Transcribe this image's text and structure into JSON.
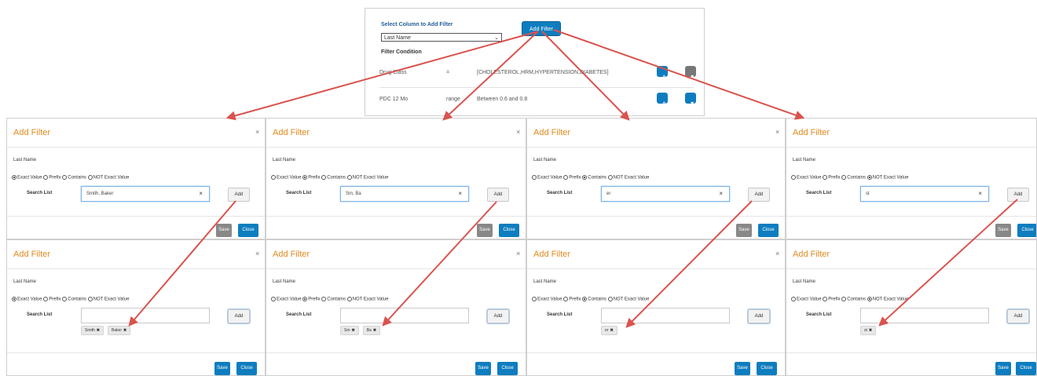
{
  "top": {
    "select_label": "Select Column to Add Filter",
    "select_value": "Last Name",
    "add_filter": "Add Filter",
    "condition_heading": "Filter Condition",
    "rows": [
      {
        "column": "Drug Class",
        "op": "=",
        "value": "[CHOLESTEROL,HRM,HYPERTENSION,DIABETES]"
      },
      {
        "column": "PDC 12 Mo",
        "op": "range",
        "value": "Between 0.6 and 0.8"
      }
    ]
  },
  "dialog_common": {
    "title": "Add Filter",
    "close": "×",
    "field": "Last Name",
    "opt_exact": "Exact Value",
    "opt_prefix": "Prefix",
    "opt_contains": "Contains",
    "opt_not_exact": "NOT Exact Value",
    "search_list": "Search List",
    "add": "Add",
    "save": "Save",
    "close_btn": "Close",
    "clear": "×",
    "tag_remove": "✖"
  },
  "dialogs_before": [
    {
      "mode": "exact",
      "input": "Smith, Baker"
    },
    {
      "mode": "prefix",
      "input": "Sm, Ba"
    },
    {
      "mode": "contains",
      "input": "er"
    },
    {
      "mode": "not_exact",
      "input": "st"
    }
  ],
  "dialogs_after": [
    {
      "mode": "exact",
      "tags": [
        "Smith",
        "Baker"
      ]
    },
    {
      "mode": "prefix",
      "tags": [
        "Sm",
        "Ba"
      ]
    },
    {
      "mode": "contains",
      "tags": [
        "er"
      ]
    },
    {
      "mode": "not_exact",
      "tags": [
        "st"
      ]
    }
  ],
  "colors": {
    "accent": "#0e7dbf",
    "title": "#e08a1e",
    "arrow": "#d9534f"
  }
}
